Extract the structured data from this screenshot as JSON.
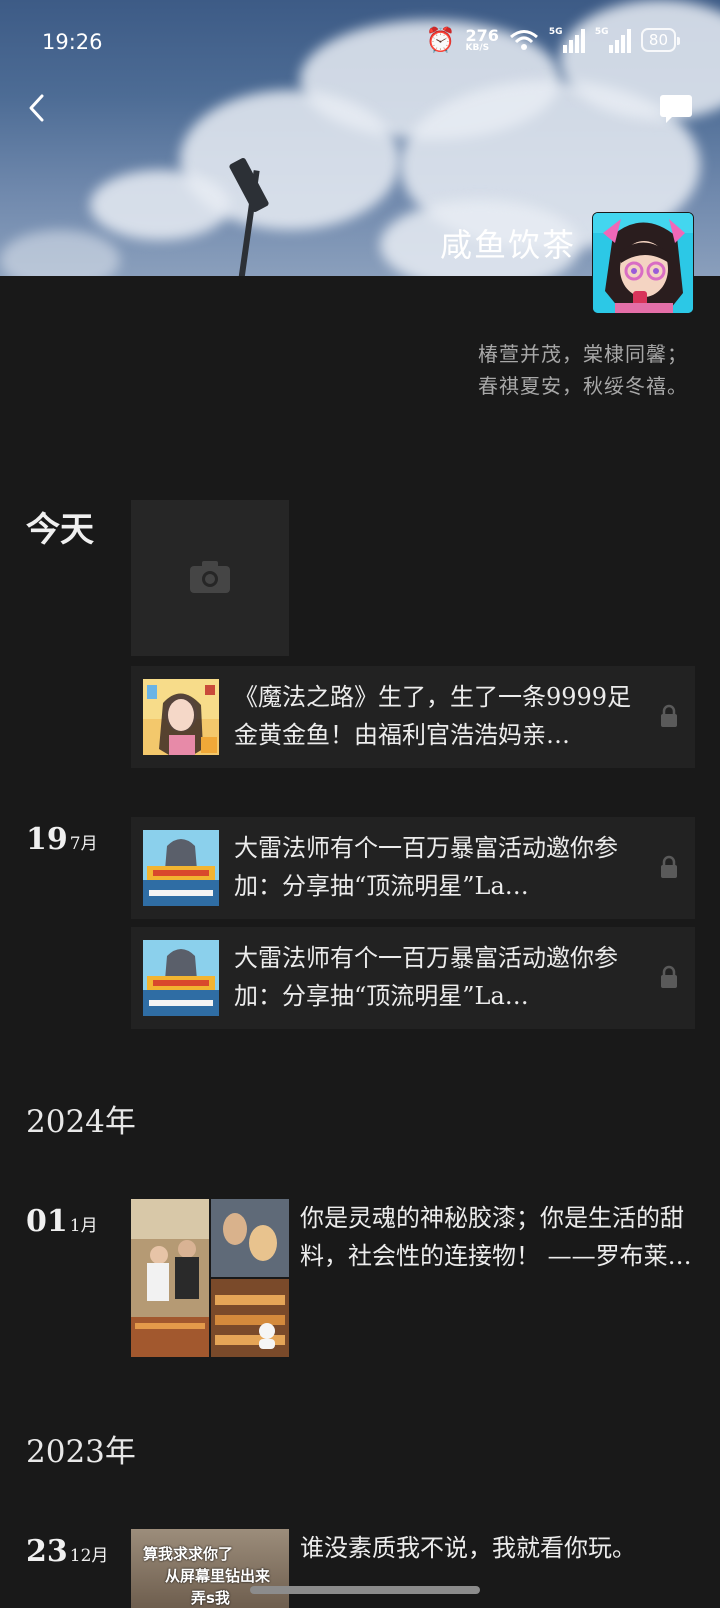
{
  "status_bar": {
    "time": "19:26",
    "net_speed": "276",
    "net_unit": "KB/S",
    "sim1": "5G",
    "sim2": "5G",
    "battery": "80",
    "icons": [
      "alarm-icon",
      "wifi-icon",
      "signal-icon",
      "signal-icon",
      "battery-icon"
    ]
  },
  "header": {
    "back_icon": "chevron-left-icon",
    "message_icon": "comment-icon"
  },
  "profile": {
    "name": "咸鱼饮茶",
    "signature_line1": "椿萱并茂，棠棣同馨；",
    "signature_line2": "春祺夏安，秋绥冬禧。"
  },
  "timeline": {
    "today": {
      "label": "今天",
      "camera_icon": "camera-icon",
      "share": {
        "text": "《魔法之路》生了，生了一条9999足金黄金鱼！由福利官浩浩妈亲…",
        "lock_icon": "lock-icon"
      }
    },
    "jul19": {
      "day": "19",
      "month": "7月",
      "shares": [
        {
          "text": "大雷法师有个一百万暴富活动邀你参加：分享抽“顶流明星”La…",
          "lock_icon": "lock-icon"
        },
        {
          "text": "大雷法师有个一百万暴富活动邀你参加：分享抽“顶流明星”La…",
          "lock_icon": "lock-icon"
        }
      ]
    },
    "year_2024": {
      "label": "2024年",
      "entry": {
        "day": "01",
        "month": "1月",
        "text": "你是灵魂的神秘胶漆；你是生活的甜料，社会性的连接物！ ——罗布莱…"
      }
    },
    "year_2023": {
      "label": "2023年",
      "entry": {
        "day": "23",
        "month": "12月",
        "text": "谁没素质我不说，我就看你玩。",
        "thumb_caption1": "算我求求你了",
        "thumb_caption2": "从屏幕里钻出来",
        "thumb_caption3": "弄s我"
      }
    }
  }
}
